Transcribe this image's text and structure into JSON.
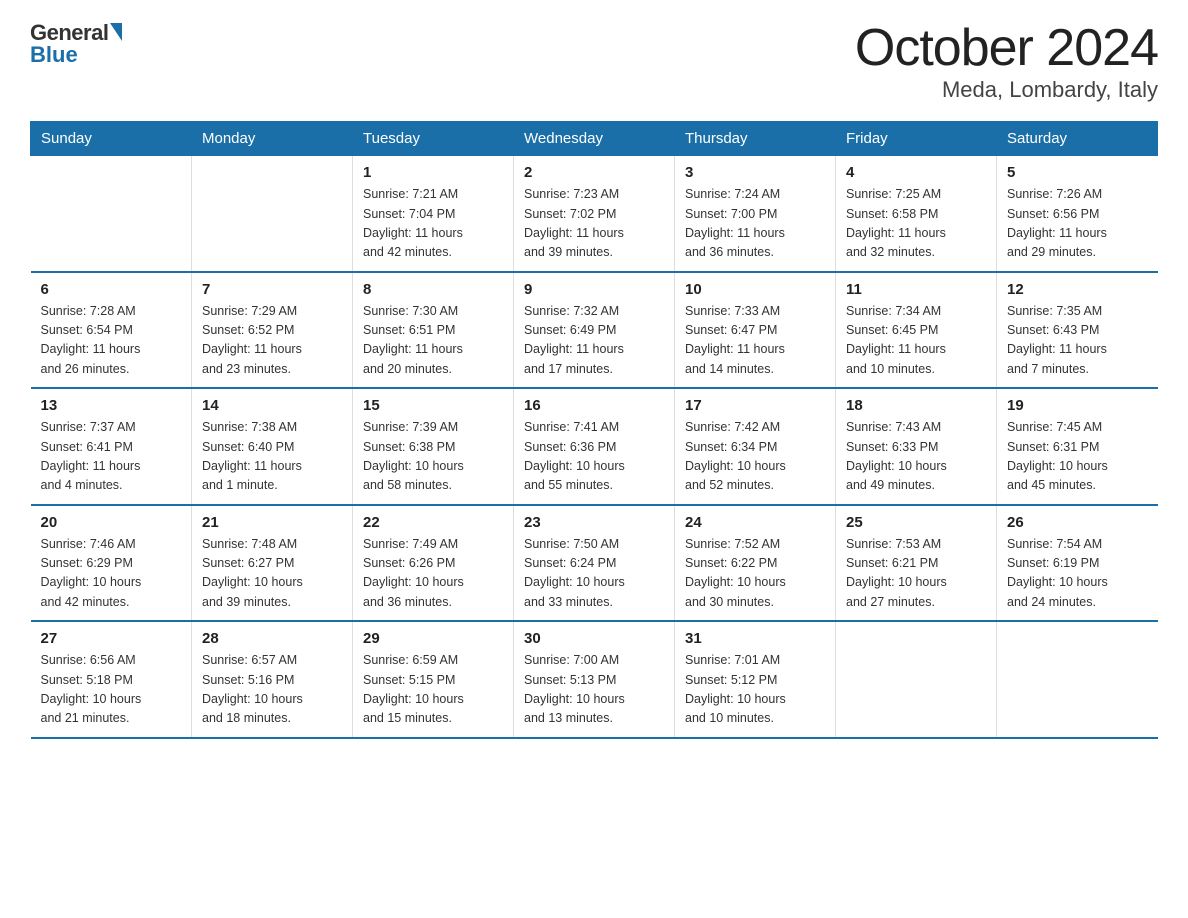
{
  "logo": {
    "general": "General",
    "blue": "Blue"
  },
  "title": "October 2024",
  "subtitle": "Meda, Lombardy, Italy",
  "days_header": [
    "Sunday",
    "Monday",
    "Tuesday",
    "Wednesday",
    "Thursday",
    "Friday",
    "Saturday"
  ],
  "weeks": [
    [
      {
        "day": "",
        "info": ""
      },
      {
        "day": "",
        "info": ""
      },
      {
        "day": "1",
        "info": "Sunrise: 7:21 AM\nSunset: 7:04 PM\nDaylight: 11 hours\nand 42 minutes."
      },
      {
        "day": "2",
        "info": "Sunrise: 7:23 AM\nSunset: 7:02 PM\nDaylight: 11 hours\nand 39 minutes."
      },
      {
        "day": "3",
        "info": "Sunrise: 7:24 AM\nSunset: 7:00 PM\nDaylight: 11 hours\nand 36 minutes."
      },
      {
        "day": "4",
        "info": "Sunrise: 7:25 AM\nSunset: 6:58 PM\nDaylight: 11 hours\nand 32 minutes."
      },
      {
        "day": "5",
        "info": "Sunrise: 7:26 AM\nSunset: 6:56 PM\nDaylight: 11 hours\nand 29 minutes."
      }
    ],
    [
      {
        "day": "6",
        "info": "Sunrise: 7:28 AM\nSunset: 6:54 PM\nDaylight: 11 hours\nand 26 minutes."
      },
      {
        "day": "7",
        "info": "Sunrise: 7:29 AM\nSunset: 6:52 PM\nDaylight: 11 hours\nand 23 minutes."
      },
      {
        "day": "8",
        "info": "Sunrise: 7:30 AM\nSunset: 6:51 PM\nDaylight: 11 hours\nand 20 minutes."
      },
      {
        "day": "9",
        "info": "Sunrise: 7:32 AM\nSunset: 6:49 PM\nDaylight: 11 hours\nand 17 minutes."
      },
      {
        "day": "10",
        "info": "Sunrise: 7:33 AM\nSunset: 6:47 PM\nDaylight: 11 hours\nand 14 minutes."
      },
      {
        "day": "11",
        "info": "Sunrise: 7:34 AM\nSunset: 6:45 PM\nDaylight: 11 hours\nand 10 minutes."
      },
      {
        "day": "12",
        "info": "Sunrise: 7:35 AM\nSunset: 6:43 PM\nDaylight: 11 hours\nand 7 minutes."
      }
    ],
    [
      {
        "day": "13",
        "info": "Sunrise: 7:37 AM\nSunset: 6:41 PM\nDaylight: 11 hours\nand 4 minutes."
      },
      {
        "day": "14",
        "info": "Sunrise: 7:38 AM\nSunset: 6:40 PM\nDaylight: 11 hours\nand 1 minute."
      },
      {
        "day": "15",
        "info": "Sunrise: 7:39 AM\nSunset: 6:38 PM\nDaylight: 10 hours\nand 58 minutes."
      },
      {
        "day": "16",
        "info": "Sunrise: 7:41 AM\nSunset: 6:36 PM\nDaylight: 10 hours\nand 55 minutes."
      },
      {
        "day": "17",
        "info": "Sunrise: 7:42 AM\nSunset: 6:34 PM\nDaylight: 10 hours\nand 52 minutes."
      },
      {
        "day": "18",
        "info": "Sunrise: 7:43 AM\nSunset: 6:33 PM\nDaylight: 10 hours\nand 49 minutes."
      },
      {
        "day": "19",
        "info": "Sunrise: 7:45 AM\nSunset: 6:31 PM\nDaylight: 10 hours\nand 45 minutes."
      }
    ],
    [
      {
        "day": "20",
        "info": "Sunrise: 7:46 AM\nSunset: 6:29 PM\nDaylight: 10 hours\nand 42 minutes."
      },
      {
        "day": "21",
        "info": "Sunrise: 7:48 AM\nSunset: 6:27 PM\nDaylight: 10 hours\nand 39 minutes."
      },
      {
        "day": "22",
        "info": "Sunrise: 7:49 AM\nSunset: 6:26 PM\nDaylight: 10 hours\nand 36 minutes."
      },
      {
        "day": "23",
        "info": "Sunrise: 7:50 AM\nSunset: 6:24 PM\nDaylight: 10 hours\nand 33 minutes."
      },
      {
        "day": "24",
        "info": "Sunrise: 7:52 AM\nSunset: 6:22 PM\nDaylight: 10 hours\nand 30 minutes."
      },
      {
        "day": "25",
        "info": "Sunrise: 7:53 AM\nSunset: 6:21 PM\nDaylight: 10 hours\nand 27 minutes."
      },
      {
        "day": "26",
        "info": "Sunrise: 7:54 AM\nSunset: 6:19 PM\nDaylight: 10 hours\nand 24 minutes."
      }
    ],
    [
      {
        "day": "27",
        "info": "Sunrise: 6:56 AM\nSunset: 5:18 PM\nDaylight: 10 hours\nand 21 minutes."
      },
      {
        "day": "28",
        "info": "Sunrise: 6:57 AM\nSunset: 5:16 PM\nDaylight: 10 hours\nand 18 minutes."
      },
      {
        "day": "29",
        "info": "Sunrise: 6:59 AM\nSunset: 5:15 PM\nDaylight: 10 hours\nand 15 minutes."
      },
      {
        "day": "30",
        "info": "Sunrise: 7:00 AM\nSunset: 5:13 PM\nDaylight: 10 hours\nand 13 minutes."
      },
      {
        "day": "31",
        "info": "Sunrise: 7:01 AM\nSunset: 5:12 PM\nDaylight: 10 hours\nand 10 minutes."
      },
      {
        "day": "",
        "info": ""
      },
      {
        "day": "",
        "info": ""
      }
    ]
  ]
}
